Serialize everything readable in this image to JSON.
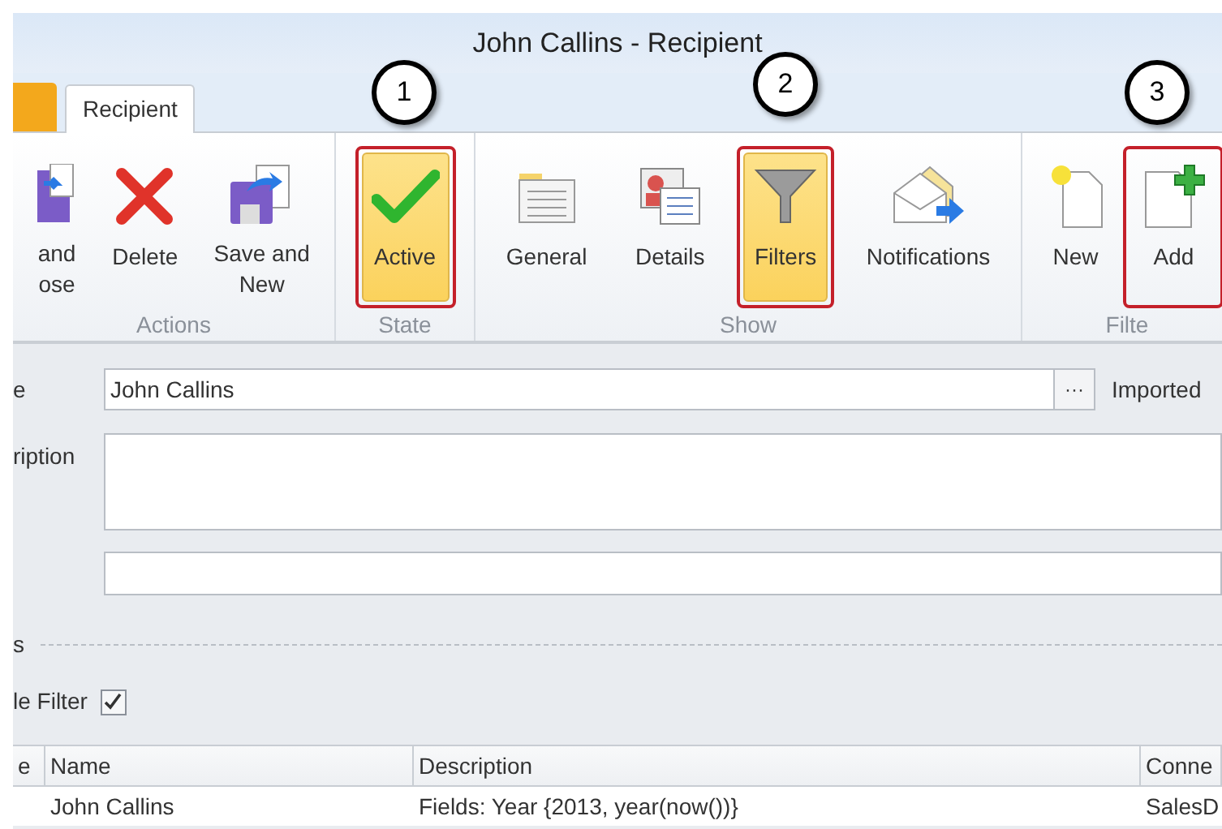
{
  "window": {
    "title": "John Callins - Recipient"
  },
  "tabs": [
    {
      "label": "Recipient",
      "selected": true
    }
  ],
  "ribbon": [
    {
      "label": "Actions",
      "buttons": [
        {
          "kind": "saveclose",
          "lines": [
            "and",
            "ose"
          ],
          "selected": false,
          "outlined": false
        },
        {
          "kind": "delete",
          "lines": [
            "Delete"
          ],
          "selected": false,
          "outlined": false
        },
        {
          "kind": "savenew",
          "lines": [
            "Save and",
            "New"
          ],
          "selected": false,
          "outlined": false
        }
      ]
    },
    {
      "label": "State",
      "buttons": [
        {
          "kind": "check",
          "lines": [
            "Active"
          ],
          "selected": true,
          "outlined": true
        }
      ]
    },
    {
      "label": "Show",
      "buttons": [
        {
          "kind": "general",
          "lines": [
            "General"
          ],
          "selected": false,
          "outlined": false
        },
        {
          "kind": "details",
          "lines": [
            "Details"
          ],
          "selected": false,
          "outlined": false
        },
        {
          "kind": "filter",
          "lines": [
            "Filters"
          ],
          "selected": true,
          "outlined": true
        },
        {
          "kind": "notify",
          "lines": [
            "Notifications"
          ],
          "selected": false,
          "outlined": false
        }
      ]
    },
    {
      "label": "Filte",
      "buttons": [
        {
          "kind": "new",
          "lines": [
            "New"
          ],
          "selected": false,
          "outlined": false
        },
        {
          "kind": "add",
          "lines": [
            "Add"
          ],
          "selected": false,
          "outlined": true
        }
      ]
    }
  ],
  "callouts": [
    "1",
    "2",
    "3"
  ],
  "form": {
    "name_label": "e",
    "name_value": "John Callins",
    "browse": "···",
    "imported_label": "Imported",
    "description_label": "ription",
    "section_label": "s",
    "filter_label": "le Filter",
    "filter_checked": true
  },
  "table": {
    "columns": [
      "e",
      "Name",
      "Description",
      "Conne"
    ],
    "rows": [
      [
        "",
        "John Callins",
        "Fields: Year {2013, year(now())}",
        "SalesD"
      ]
    ]
  }
}
